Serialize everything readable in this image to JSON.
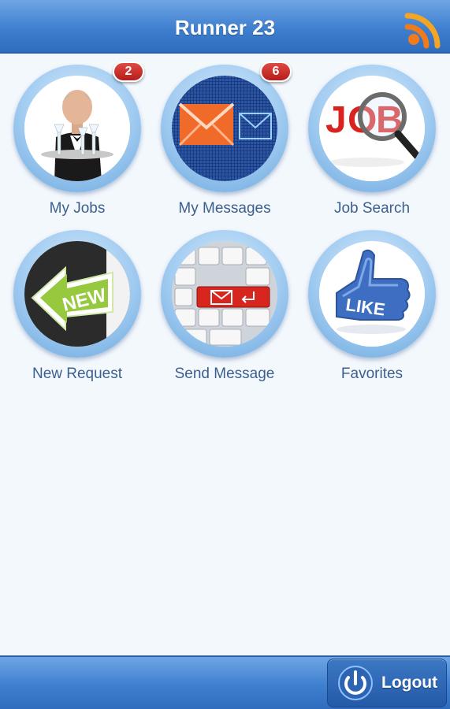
{
  "header": {
    "title": "Runner 23",
    "feed_icon": "rss-feed-icon"
  },
  "tiles": [
    {
      "label": "My Jobs",
      "icon": "waiter-tray-icon",
      "badge": "2"
    },
    {
      "label": "My Messages",
      "icon": "envelope-icon",
      "badge": "6"
    },
    {
      "label": "Job Search",
      "icon": "job-magnifier-icon",
      "badge": null
    },
    {
      "label": "New Request",
      "icon": "new-arrow-icon",
      "badge": null
    },
    {
      "label": "Send Message",
      "icon": "keyboard-mail-key-icon",
      "badge": null
    },
    {
      "label": "Favorites",
      "icon": "like-thumb-icon",
      "badge": null
    }
  ],
  "footer": {
    "logout_label": "Logout",
    "logout_icon": "power-icon"
  },
  "colors": {
    "header_blue": "#3f7fcf",
    "label_text": "#3d5f8f",
    "badge_red": "#c22622",
    "ring_blue": "#9fcaf0",
    "feed_orange": "#f07a1c"
  }
}
